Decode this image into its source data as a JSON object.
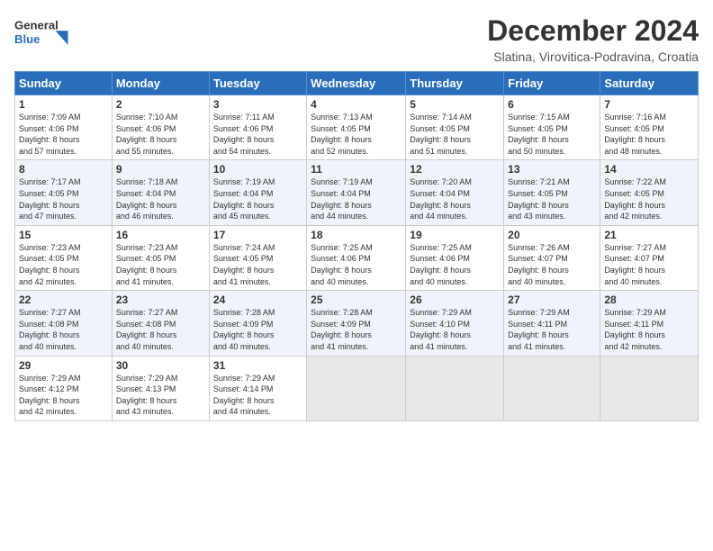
{
  "header": {
    "logo_general": "General",
    "logo_blue": "Blue",
    "title": "December 2024",
    "subtitle": "Slatina, Virovitica-Podravina, Croatia"
  },
  "calendar": {
    "days_of_week": [
      "Sunday",
      "Monday",
      "Tuesday",
      "Wednesday",
      "Thursday",
      "Friday",
      "Saturday"
    ],
    "weeks": [
      [
        {
          "day": "1",
          "info": "Sunrise: 7:09 AM\nSunset: 4:06 PM\nDaylight: 8 hours\nand 57 minutes."
        },
        {
          "day": "2",
          "info": "Sunrise: 7:10 AM\nSunset: 4:06 PM\nDaylight: 8 hours\nand 55 minutes."
        },
        {
          "day": "3",
          "info": "Sunrise: 7:11 AM\nSunset: 4:06 PM\nDaylight: 8 hours\nand 54 minutes."
        },
        {
          "day": "4",
          "info": "Sunrise: 7:13 AM\nSunset: 4:05 PM\nDaylight: 8 hours\nand 52 minutes."
        },
        {
          "day": "5",
          "info": "Sunrise: 7:14 AM\nSunset: 4:05 PM\nDaylight: 8 hours\nand 51 minutes."
        },
        {
          "day": "6",
          "info": "Sunrise: 7:15 AM\nSunset: 4:05 PM\nDaylight: 8 hours\nand 50 minutes."
        },
        {
          "day": "7",
          "info": "Sunrise: 7:16 AM\nSunset: 4:05 PM\nDaylight: 8 hours\nand 48 minutes."
        }
      ],
      [
        {
          "day": "8",
          "info": "Sunrise: 7:17 AM\nSunset: 4:05 PM\nDaylight: 8 hours\nand 47 minutes."
        },
        {
          "day": "9",
          "info": "Sunrise: 7:18 AM\nSunset: 4:04 PM\nDaylight: 8 hours\nand 46 minutes."
        },
        {
          "day": "10",
          "info": "Sunrise: 7:19 AM\nSunset: 4:04 PM\nDaylight: 8 hours\nand 45 minutes."
        },
        {
          "day": "11",
          "info": "Sunrise: 7:19 AM\nSunset: 4:04 PM\nDaylight: 8 hours\nand 44 minutes."
        },
        {
          "day": "12",
          "info": "Sunrise: 7:20 AM\nSunset: 4:04 PM\nDaylight: 8 hours\nand 44 minutes."
        },
        {
          "day": "13",
          "info": "Sunrise: 7:21 AM\nSunset: 4:05 PM\nDaylight: 8 hours\nand 43 minutes."
        },
        {
          "day": "14",
          "info": "Sunrise: 7:22 AM\nSunset: 4:05 PM\nDaylight: 8 hours\nand 42 minutes."
        }
      ],
      [
        {
          "day": "15",
          "info": "Sunrise: 7:23 AM\nSunset: 4:05 PM\nDaylight: 8 hours\nand 42 minutes."
        },
        {
          "day": "16",
          "info": "Sunrise: 7:23 AM\nSunset: 4:05 PM\nDaylight: 8 hours\nand 41 minutes."
        },
        {
          "day": "17",
          "info": "Sunrise: 7:24 AM\nSunset: 4:05 PM\nDaylight: 8 hours\nand 41 minutes."
        },
        {
          "day": "18",
          "info": "Sunrise: 7:25 AM\nSunset: 4:06 PM\nDaylight: 8 hours\nand 40 minutes."
        },
        {
          "day": "19",
          "info": "Sunrise: 7:25 AM\nSunset: 4:06 PM\nDaylight: 8 hours\nand 40 minutes."
        },
        {
          "day": "20",
          "info": "Sunrise: 7:26 AM\nSunset: 4:07 PM\nDaylight: 8 hours\nand 40 minutes."
        },
        {
          "day": "21",
          "info": "Sunrise: 7:27 AM\nSunset: 4:07 PM\nDaylight: 8 hours\nand 40 minutes."
        }
      ],
      [
        {
          "day": "22",
          "info": "Sunrise: 7:27 AM\nSunset: 4:08 PM\nDaylight: 8 hours\nand 40 minutes."
        },
        {
          "day": "23",
          "info": "Sunrise: 7:27 AM\nSunset: 4:08 PM\nDaylight: 8 hours\nand 40 minutes."
        },
        {
          "day": "24",
          "info": "Sunrise: 7:28 AM\nSunset: 4:09 PM\nDaylight: 8 hours\nand 40 minutes."
        },
        {
          "day": "25",
          "info": "Sunrise: 7:28 AM\nSunset: 4:09 PM\nDaylight: 8 hours\nand 41 minutes."
        },
        {
          "day": "26",
          "info": "Sunrise: 7:29 AM\nSunset: 4:10 PM\nDaylight: 8 hours\nand 41 minutes."
        },
        {
          "day": "27",
          "info": "Sunrise: 7:29 AM\nSunset: 4:11 PM\nDaylight: 8 hours\nand 41 minutes."
        },
        {
          "day": "28",
          "info": "Sunrise: 7:29 AM\nSunset: 4:11 PM\nDaylight: 8 hours\nand 42 minutes."
        }
      ],
      [
        {
          "day": "29",
          "info": "Sunrise: 7:29 AM\nSunset: 4:12 PM\nDaylight: 8 hours\nand 42 minutes."
        },
        {
          "day": "30",
          "info": "Sunrise: 7:29 AM\nSunset: 4:13 PM\nDaylight: 8 hours\nand 43 minutes."
        },
        {
          "day": "31",
          "info": "Sunrise: 7:29 AM\nSunset: 4:14 PM\nDaylight: 8 hours\nand 44 minutes."
        },
        {
          "day": "",
          "info": ""
        },
        {
          "day": "",
          "info": ""
        },
        {
          "day": "",
          "info": ""
        },
        {
          "day": "",
          "info": ""
        }
      ]
    ]
  }
}
